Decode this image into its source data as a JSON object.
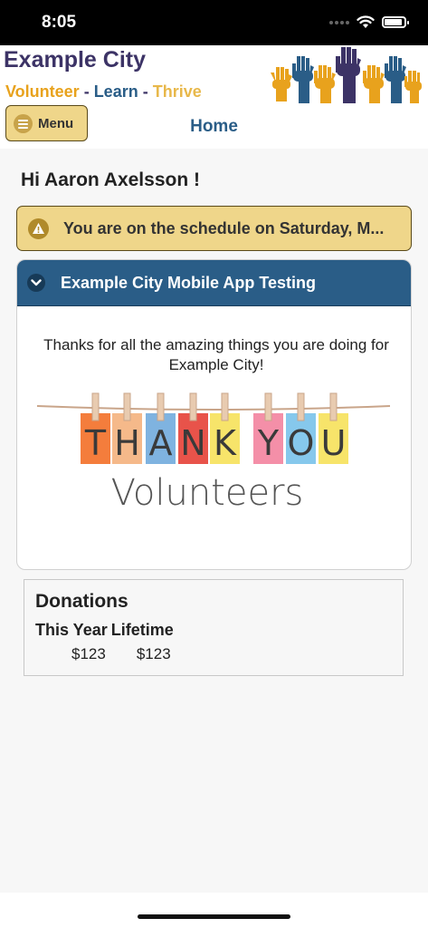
{
  "status_bar": {
    "time": "8:05"
  },
  "header": {
    "brand_title": "Example City",
    "tagline": {
      "part1": "Volunteer",
      "sep1": "-",
      "part2": "Learn",
      "sep2": "-",
      "part3": "Thrive"
    },
    "menu_label": "Menu",
    "nav_title": "Home"
  },
  "greeting": "Hi Aaron Axelsson !",
  "alert": {
    "text": "You are on the schedule on Saturday, M..."
  },
  "panel": {
    "title": "Example City Mobile App Testing",
    "thanks_text": "Thanks for all the amazing things you are doing for Example City!",
    "banner": {
      "letters": [
        "T",
        "H",
        "A",
        "N",
        "K",
        "Y",
        "O",
        "U"
      ],
      "subtitle": "Volunteers"
    }
  },
  "donations": {
    "title": "Donations",
    "col_this_year": "This Year",
    "col_lifetime": "Lifetime",
    "this_year_value": "$123",
    "lifetime_value": "$123"
  },
  "colors": {
    "brand_purple": "#3c3366",
    "brand_blue": "#2a5d87",
    "brand_orange": "#e8a21d",
    "button_yellow": "#efd68a"
  }
}
